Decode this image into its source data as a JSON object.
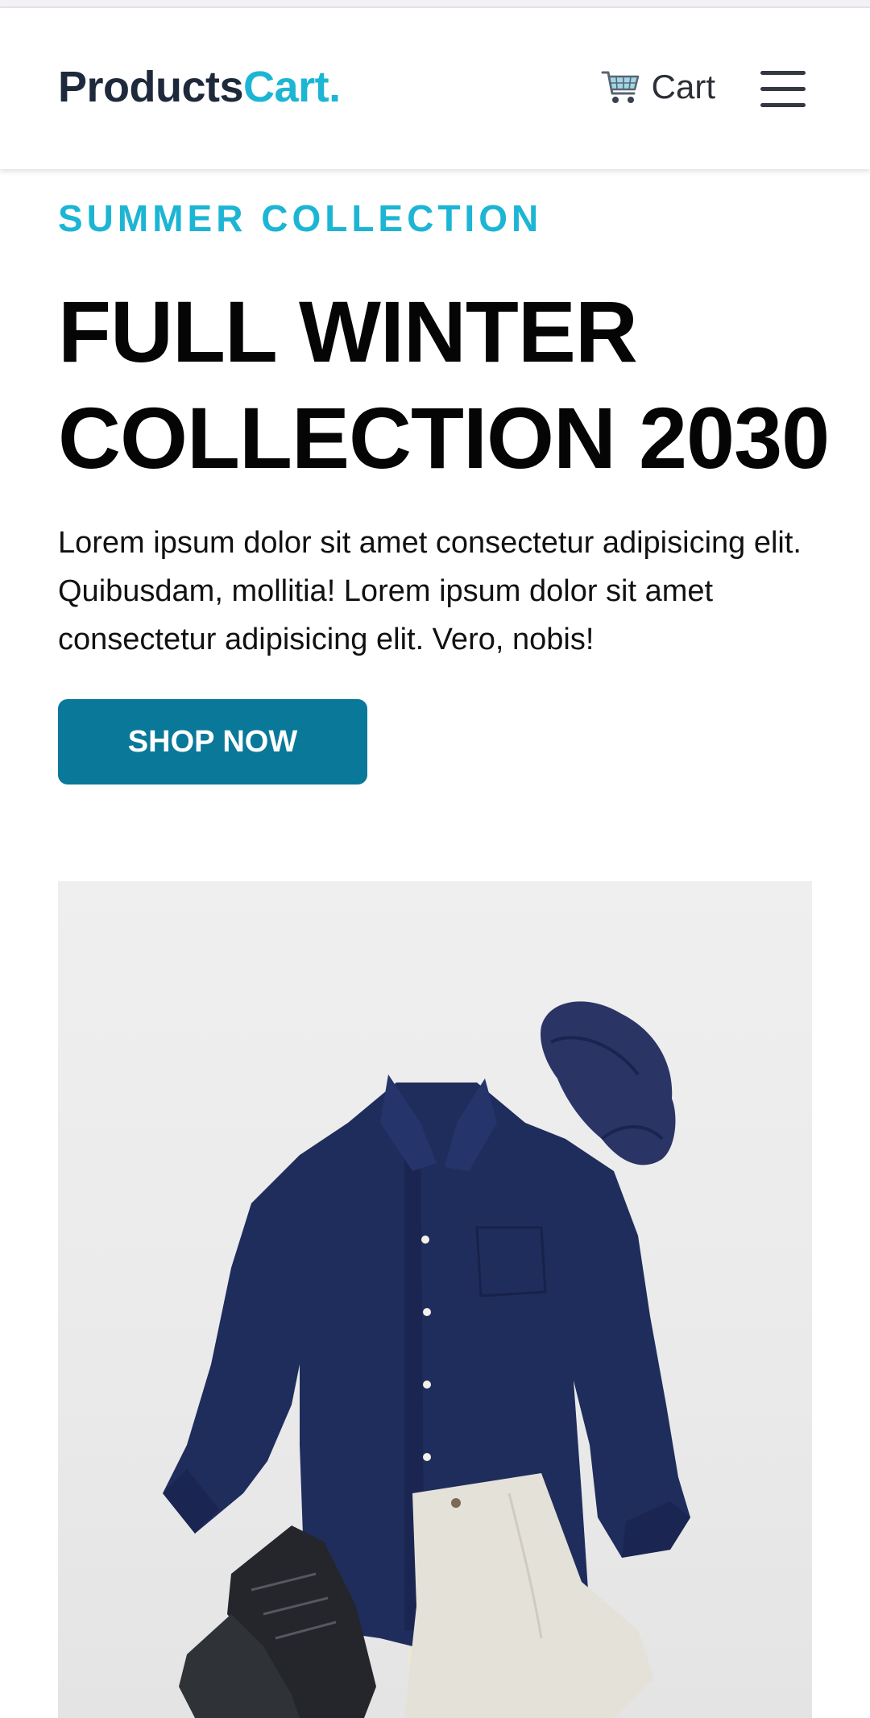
{
  "navbar": {
    "brand_part1": "Products",
    "brand_part2": "Cart.",
    "cart_label": "Cart",
    "cart_icon": "shopping-cart-icon",
    "menu_icon": "hamburger-menu-icon"
  },
  "hero": {
    "eyebrow": "SUMMER COLLECTION",
    "headline_line1": "FULL WINTER",
    "headline_line2": "COLLECTION 2030",
    "description": "Lorem ipsum dolor sit amet consectetur adipisicing elit. Quibusdam, mollitia! Lorem ipsum dolor sit amet consectetur adipisicing elit. Vero, nobis!",
    "cta_label": "SHOP NOW"
  },
  "colors": {
    "brand_dark": "#1e2a3b",
    "accent": "#1cb5d4",
    "button": "#097899",
    "shirt": "#1f2d5c"
  }
}
